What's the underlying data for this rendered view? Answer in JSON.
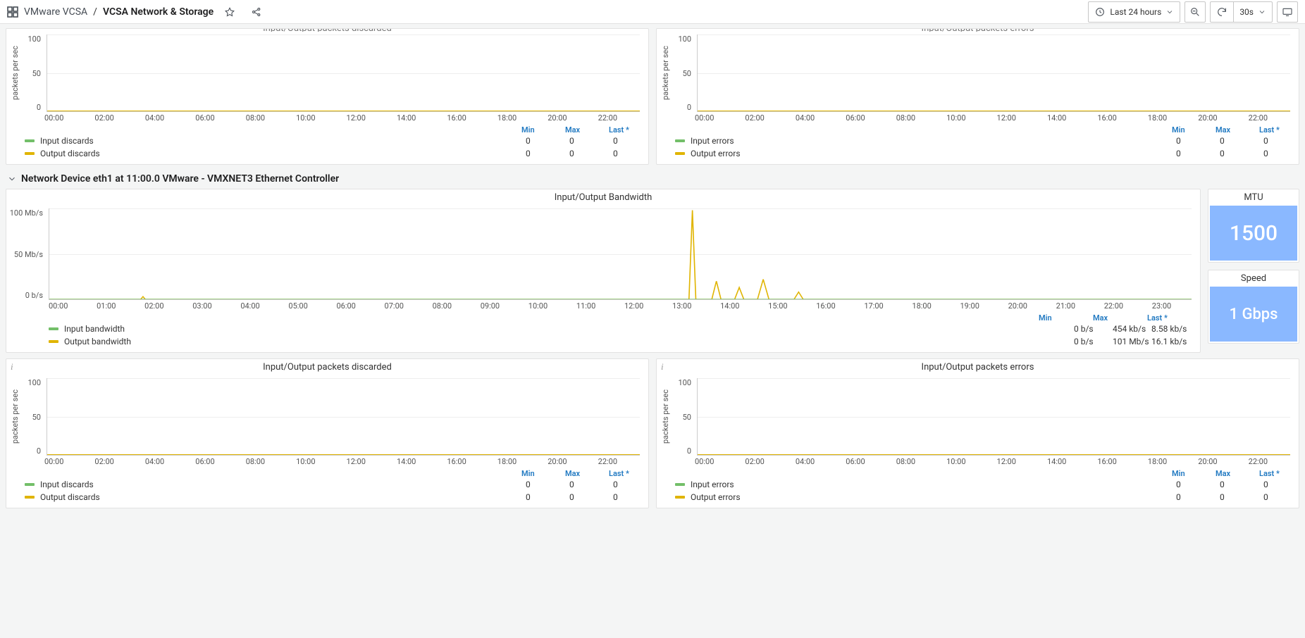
{
  "header": {
    "breadcrumb_folder": "VMware VCSA",
    "breadcrumb_sep": "/",
    "breadcrumb_title": "VCSA Network & Storage",
    "time_range": "Last 24 hours",
    "refresh_interval": "30s"
  },
  "row_title": "Network Device eth1 at 11:00.0 VMware - VMXNET3 Ethernet Controller",
  "legend_headers": {
    "min": "Min",
    "max": "Max",
    "last": "Last *"
  },
  "panels_top": [
    {
      "title_clipped": "Input/Output packets discarded",
      "ylabel": "packets per sec",
      "yticks": [
        "100",
        "50",
        "0"
      ],
      "xticks": [
        "00:00",
        "02:00",
        "04:00",
        "06:00",
        "08:00",
        "10:00",
        "12:00",
        "14:00",
        "16:00",
        "18:00",
        "20:00",
        "22:00"
      ],
      "series": [
        {
          "color": "green",
          "label": "Input discards",
          "min": "0",
          "max": "0",
          "last": "0"
        },
        {
          "color": "yellow",
          "label": "Output discards",
          "min": "0",
          "max": "0",
          "last": "0"
        }
      ]
    },
    {
      "title_clipped": "Input/Output packets errors",
      "ylabel": "packets per sec",
      "yticks": [
        "100",
        "50",
        "0"
      ],
      "xticks": [
        "00:00",
        "02:00",
        "04:00",
        "06:00",
        "08:00",
        "10:00",
        "12:00",
        "14:00",
        "16:00",
        "18:00",
        "20:00",
        "22:00"
      ],
      "series": [
        {
          "color": "green",
          "label": "Input errors",
          "min": "0",
          "max": "0",
          "last": "0"
        },
        {
          "color": "yellow",
          "label": "Output errors",
          "min": "0",
          "max": "0",
          "last": "0"
        }
      ]
    }
  ],
  "panel_bandwidth": {
    "title": "Input/Output Bandwidth",
    "yticks": [
      "100 Mb/s",
      "50 Mb/s",
      "0 b/s"
    ],
    "xticks": [
      "00:00",
      "01:00",
      "02:00",
      "03:00",
      "04:00",
      "05:00",
      "06:00",
      "07:00",
      "08:00",
      "09:00",
      "10:00",
      "11:00",
      "12:00",
      "13:00",
      "14:00",
      "15:00",
      "16:00",
      "17:00",
      "18:00",
      "19:00",
      "20:00",
      "21:00",
      "22:00",
      "23:00"
    ],
    "series": [
      {
        "color": "green",
        "label": "Input bandwidth",
        "min": "0 b/s",
        "max": "454 kb/s",
        "last": "8.58 kb/s"
      },
      {
        "color": "yellow",
        "label": "Output bandwidth",
        "min": "0 b/s",
        "max": "101 Mb/s",
        "last": "16.1 kb/s"
      }
    ]
  },
  "stat_mtu": {
    "title": "MTU",
    "value": "1500"
  },
  "stat_speed": {
    "title": "Speed",
    "value": "1 Gbps"
  },
  "panels_bottom": [
    {
      "title": "Input/Output packets discarded",
      "ylabel": "packets per sec",
      "yticks": [
        "100",
        "50",
        "0"
      ],
      "xticks": [
        "00:00",
        "02:00",
        "04:00",
        "06:00",
        "08:00",
        "10:00",
        "12:00",
        "14:00",
        "16:00",
        "18:00",
        "20:00",
        "22:00"
      ],
      "series": [
        {
          "color": "green",
          "label": "Input discards",
          "min": "0",
          "max": "0",
          "last": "0"
        },
        {
          "color": "yellow",
          "label": "Output discards",
          "min": "0",
          "max": "0",
          "last": "0"
        }
      ]
    },
    {
      "title": "Input/Output packets errors",
      "ylabel": "packets per sec",
      "yticks": [
        "100",
        "50",
        "0"
      ],
      "xticks": [
        "00:00",
        "02:00",
        "04:00",
        "06:00",
        "08:00",
        "10:00",
        "12:00",
        "14:00",
        "16:00",
        "18:00",
        "20:00",
        "22:00"
      ],
      "series": [
        {
          "color": "green",
          "label": "Input errors",
          "min": "0",
          "max": "0",
          "last": "0"
        },
        {
          "color": "yellow",
          "label": "Output errors",
          "min": "0",
          "max": "0",
          "last": "0"
        }
      ]
    }
  ],
  "chart_data": [
    {
      "type": "line",
      "title": "Input/Output packets discarded (top-left, clipped)",
      "ylabel": "packets per sec",
      "ylim": [
        0,
        100
      ],
      "categories": [
        "00:00",
        "02:00",
        "04:00",
        "06:00",
        "08:00",
        "10:00",
        "12:00",
        "14:00",
        "16:00",
        "18:00",
        "20:00",
        "22:00"
      ],
      "series": [
        {
          "name": "Input discards",
          "values": [
            0,
            0,
            0,
            0,
            0,
            0,
            0,
            0,
            0,
            0,
            0,
            0
          ]
        },
        {
          "name": "Output discards",
          "values": [
            0,
            0,
            0,
            0,
            0,
            0,
            0,
            0,
            0,
            0,
            0,
            0
          ]
        }
      ]
    },
    {
      "type": "line",
      "title": "Input/Output packets errors (top-right, clipped)",
      "ylabel": "packets per sec",
      "ylim": [
        0,
        100
      ],
      "categories": [
        "00:00",
        "02:00",
        "04:00",
        "06:00",
        "08:00",
        "10:00",
        "12:00",
        "14:00",
        "16:00",
        "18:00",
        "20:00",
        "22:00"
      ],
      "series": [
        {
          "name": "Input errors",
          "values": [
            0,
            0,
            0,
            0,
            0,
            0,
            0,
            0,
            0,
            0,
            0,
            0
          ]
        },
        {
          "name": "Output errors",
          "values": [
            0,
            0,
            0,
            0,
            0,
            0,
            0,
            0,
            0,
            0,
            0,
            0
          ]
        }
      ]
    },
    {
      "type": "line",
      "title": "Input/Output Bandwidth",
      "ylabel": "b/s",
      "ylim": [
        0,
        100000000
      ],
      "categories": [
        "00:00",
        "01:00",
        "02:00",
        "03:00",
        "04:00",
        "05:00",
        "06:00",
        "07:00",
        "08:00",
        "09:00",
        "10:00",
        "11:00",
        "12:00",
        "13:00",
        "14:00",
        "15:00",
        "16:00",
        "17:00",
        "18:00",
        "19:00",
        "20:00",
        "21:00",
        "22:00",
        "23:00"
      ],
      "series": [
        {
          "name": "Input bandwidth",
          "values": [
            0,
            0,
            0,
            0,
            0,
            0,
            0,
            0,
            0,
            0,
            0,
            0,
            0,
            454000,
            200000,
            100000,
            0,
            0,
            0,
            0,
            0,
            0,
            0,
            8580
          ]
        },
        {
          "name": "Output bandwidth",
          "values": [
            0,
            0,
            1000000,
            0,
            0,
            0,
            0,
            0,
            0,
            0,
            0,
            0,
            0,
            101000000,
            20000000,
            10000000,
            2000000,
            0,
            0,
            0,
            0,
            0,
            0,
            16100
          ]
        }
      ]
    },
    {
      "type": "line",
      "title": "Input/Output packets discarded",
      "ylabel": "packets per sec",
      "ylim": [
        0,
        100
      ],
      "categories": [
        "00:00",
        "02:00",
        "04:00",
        "06:00",
        "08:00",
        "10:00",
        "12:00",
        "14:00",
        "16:00",
        "18:00",
        "20:00",
        "22:00"
      ],
      "series": [
        {
          "name": "Input discards",
          "values": [
            0,
            0,
            0,
            0,
            0,
            0,
            0,
            0,
            0,
            0,
            0,
            0
          ]
        },
        {
          "name": "Output discards",
          "values": [
            0,
            0,
            0,
            0,
            0,
            0,
            0,
            0,
            0,
            0,
            0,
            0
          ]
        }
      ]
    },
    {
      "type": "line",
      "title": "Input/Output packets errors",
      "ylabel": "packets per sec",
      "ylim": [
        0,
        100
      ],
      "categories": [
        "00:00",
        "02:00",
        "04:00",
        "06:00",
        "08:00",
        "10:00",
        "12:00",
        "14:00",
        "16:00",
        "18:00",
        "20:00",
        "22:00"
      ],
      "series": [
        {
          "name": "Input errors",
          "values": [
            0,
            0,
            0,
            0,
            0,
            0,
            0,
            0,
            0,
            0,
            0,
            0
          ]
        },
        {
          "name": "Output errors",
          "values": [
            0,
            0,
            0,
            0,
            0,
            0,
            0,
            0,
            0,
            0,
            0,
            0
          ]
        }
      ]
    }
  ]
}
